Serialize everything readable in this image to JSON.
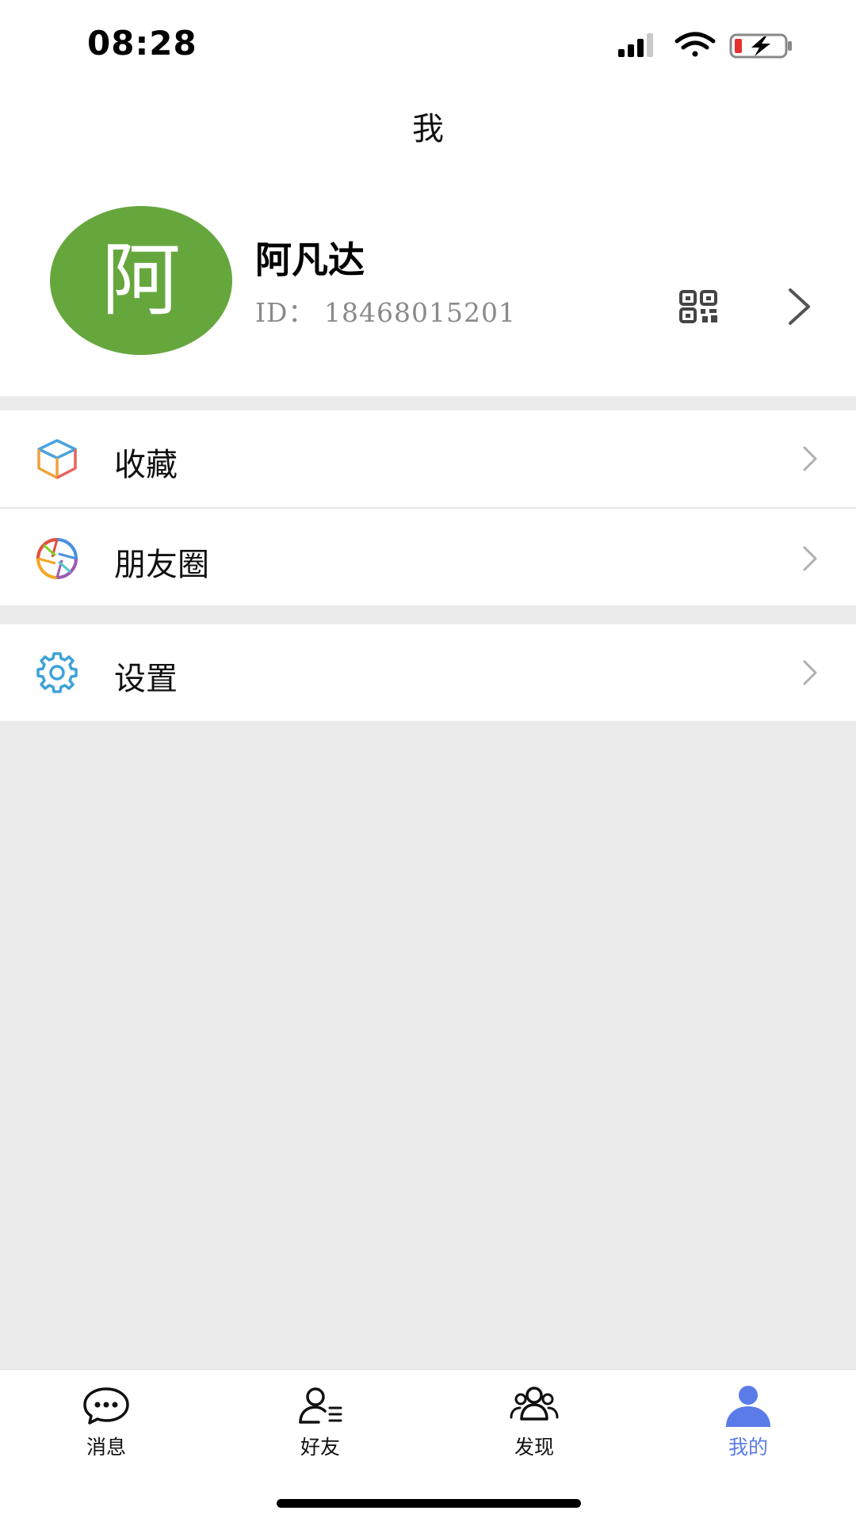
{
  "status_bar": {
    "time": "08:28",
    "icons": [
      "signal-icon",
      "wifi-icon",
      "battery-charging-icon"
    ]
  },
  "header": {
    "title": "我"
  },
  "profile": {
    "avatar_text": "阿",
    "avatar_color": "#66a73d",
    "name": "阿凡达",
    "id_text": "ID：  18468015201",
    "qr_icon": "qr-code-icon",
    "chevron_icon": "chevron-right-icon"
  },
  "menu": {
    "favorites": {
      "label": "收藏",
      "icon": "cube-icon"
    },
    "moments": {
      "label": "朋友圈",
      "icon": "aperture-icon"
    },
    "settings": {
      "label": "设置",
      "icon": "gear-icon"
    }
  },
  "tabbar": {
    "tabs": [
      {
        "label": "消息",
        "icon": "chat-bubble-icon",
        "active": false
      },
      {
        "label": "好友",
        "icon": "contact-list-icon",
        "active": false
      },
      {
        "label": "发现",
        "icon": "group-icon",
        "active": false
      },
      {
        "label": "我的",
        "icon": "person-icon",
        "active": true
      }
    ],
    "active_color": "#5b7be8"
  }
}
